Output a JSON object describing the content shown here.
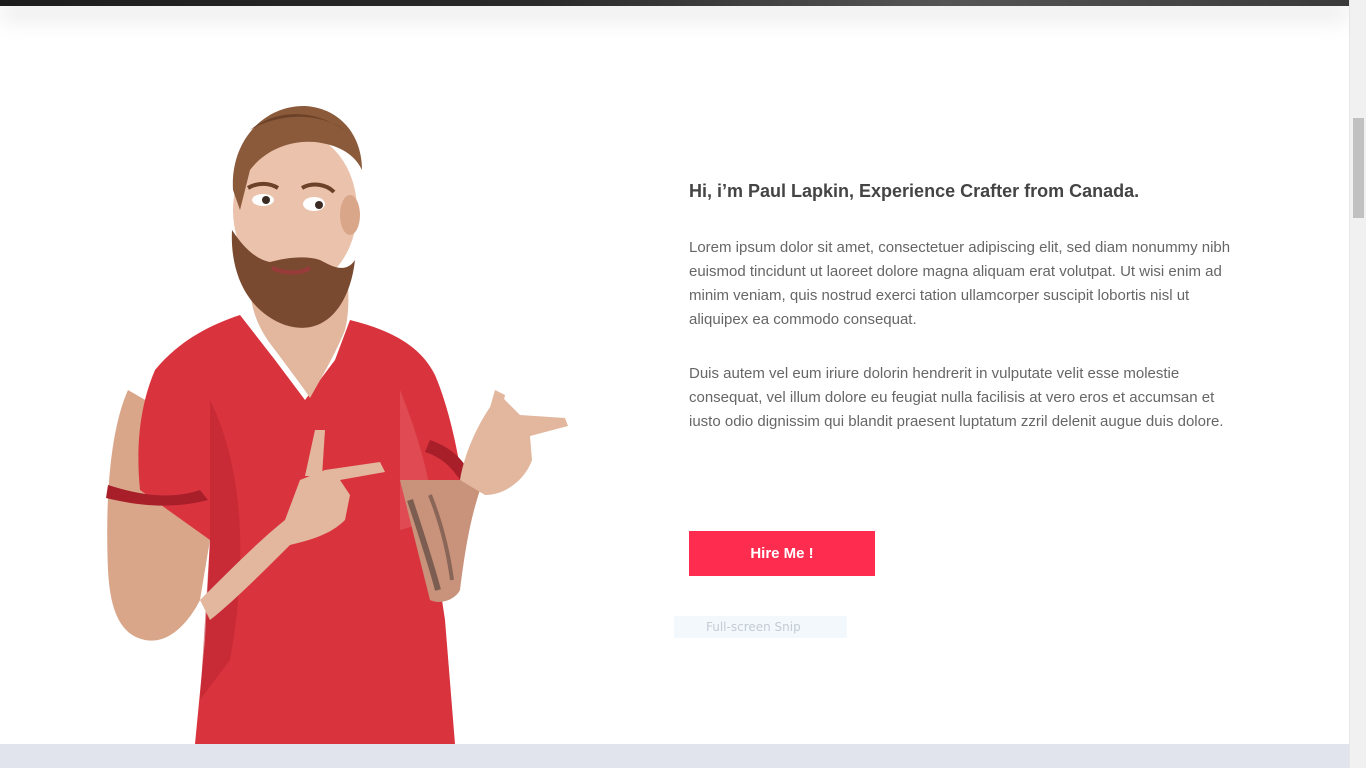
{
  "about": {
    "heading": "Hi, i’m Paul Lapkin, Experience Crafter from Canada.",
    "paragraphs": [
      "Lorem ipsum dolor sit amet, consectetuer adipiscing elit, sed diam nonummy nibh euismod tincidunt ut laoreet dolore magna aliquam erat volutpat. Ut wisi enim ad minim veniam, quis nostrud exerci tation ullamcorper suscipit lobortis nisl ut aliquipex ea commodo consequat.",
      "Duis autem vel eum iriure dolorin hendrerit in vulputate velit esse molestie consequat, vel illum dolore eu feugiat nulla facilisis at vero eros et accumsan et iusto odio dignissim qui blandit praesent luptatum zzril delenit augue duis dolore."
    ],
    "button_label": "Hire Me !"
  },
  "overlay": {
    "snip_label": "Full-screen Snip"
  },
  "colors": {
    "accent": "#fe2c4f",
    "shirt": "#d9343e",
    "bottom_band": "#e1e3ed"
  }
}
